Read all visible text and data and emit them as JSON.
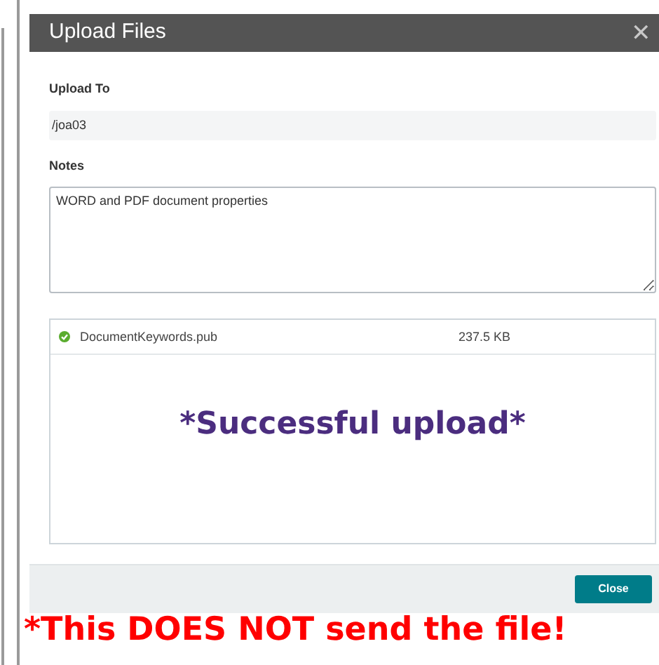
{
  "dialog": {
    "title": "Upload Files",
    "close_icon": "✕"
  },
  "upload_to": {
    "label": "Upload To",
    "value": "/joa03"
  },
  "notes": {
    "label": "Notes",
    "value": "WORD and PDF document properties"
  },
  "files": [
    {
      "name": "DocumentKeywords.pub",
      "size": "237.5 KB",
      "uploaded": true
    }
  ],
  "overlay_message": "*Successful upload*",
  "buttons": [
    {
      "label": "Close"
    }
  ],
  "warning": "*This DOES NOT send the file!"
}
